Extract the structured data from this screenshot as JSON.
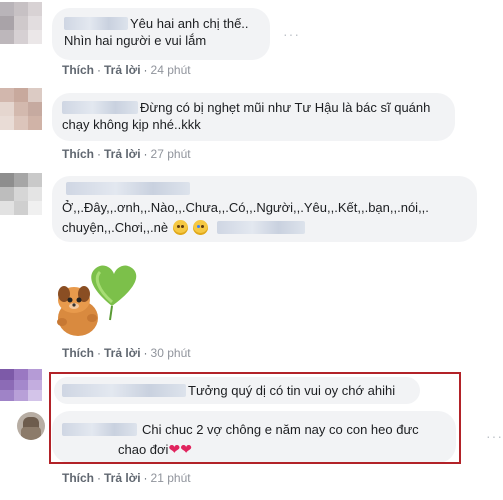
{
  "comments": [
    {
      "text": "Yêu hai anh chị thế.. Nhìn hai người e vui lắm",
      "like": "Thích",
      "reply": "Trả lời",
      "time": "24 phút",
      "more": "···"
    },
    {
      "text": "Đừng có bị nghẹt mũi như Tư Hậu là bác sĩ quánh chạy không kịp nhé..kkk",
      "like": "Thích",
      "reply": "Trả lời",
      "time": "27 phút"
    },
    {
      "text_line1": "Ở,,.Đây,,.ơnh,,.Nào,,.Chưa,,.Có,,.Người,,.Yêu,,.Kết,,.bạn,,.nói,,.",
      "text_line2": "chuyện,,.Chơi,,.nè",
      "emojis": [
        "grinning-emoji",
        "crying-emoji"
      ]
    },
    {
      "sticker": "puppy-with-heart-sticker",
      "like": "Thích",
      "reply": "Trả lời",
      "time": "30 phút"
    },
    {
      "text": "Tưởng quý dị có tin vui oy chớ ahihi"
    },
    {
      "text_line1": "Chi chuc 2 vợ chông e năm nay co con heo đưc",
      "text_line2": "chao đơi",
      "like": "Thích",
      "reply": "Trả lời",
      "time": "21 phút",
      "more": "···"
    }
  ],
  "separator": "·",
  "colors": {
    "bubble": "#f2f3f5",
    "highlight_border": "#b22228",
    "action_text": "#606770",
    "heart": "#e0245e"
  }
}
